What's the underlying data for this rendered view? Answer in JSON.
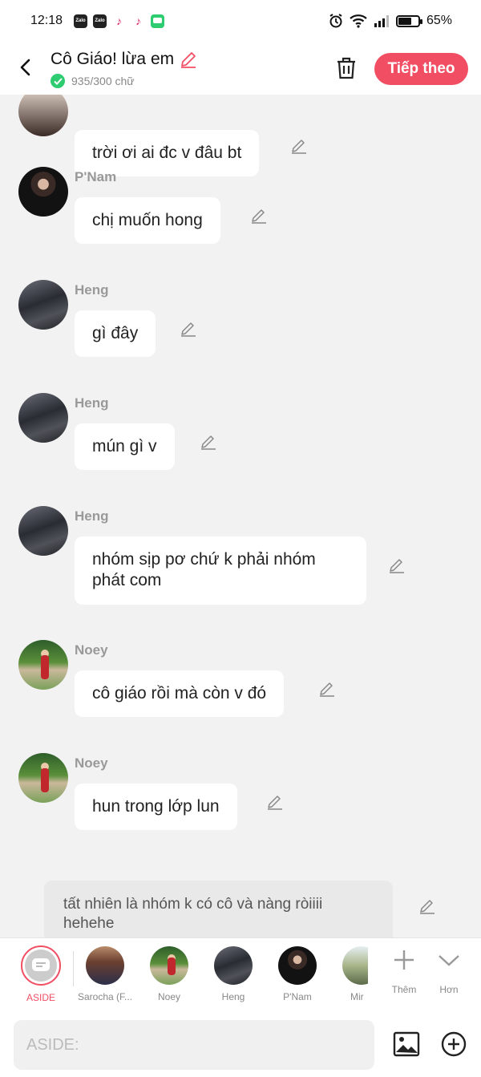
{
  "status_bar": {
    "time": "12:18",
    "apps": [
      "Zalo",
      "Zalo",
      "TikTok",
      "TikTok",
      "Messages"
    ],
    "zalo_label": "Zalo",
    "battery": "65%",
    "battery_level": 0.65
  },
  "header": {
    "title": "Cô Giáo! lừa em",
    "word_count": "935/300 chữ",
    "next_label": "Tiếp theo"
  },
  "messages": [
    {
      "name": "",
      "text": "trời ơi ai đc v đâu bt",
      "avatar": "top"
    },
    {
      "name": "P'Nam",
      "text": "chị muốn hong",
      "avatar": "pnam"
    },
    {
      "name": "Heng",
      "text": "gì đây",
      "avatar": "heng"
    },
    {
      "name": "Heng",
      "text": "mún gì v",
      "avatar": "heng"
    },
    {
      "name": "Heng",
      "text": "nhóm sịp pơ chứ k phải nhóm phát com",
      "avatar": "heng"
    },
    {
      "name": "Noey",
      "text": "cô giáo rồi mà còn v đó",
      "avatar": "noey"
    },
    {
      "name": "Noey",
      "text": "hun trong lớp lun",
      "avatar": "noey"
    }
  ],
  "aside_message": {
    "text": "tất nhiên là nhóm k có cô và nàng ròiiii hehehe"
  },
  "characters": {
    "aside_label": "ASIDE",
    "items": [
      {
        "label": "Sarocha (F..."
      },
      {
        "label": "Noey"
      },
      {
        "label": "Heng"
      },
      {
        "label": "P'Nam"
      },
      {
        "label": "Mir"
      }
    ],
    "add_label": "Thêm",
    "more_label": "Hơn"
  },
  "composer": {
    "placeholder": "ASIDE:"
  },
  "colors": {
    "accent": "#f24e63",
    "success": "#2ecc71",
    "background": "#f2f2f2"
  }
}
